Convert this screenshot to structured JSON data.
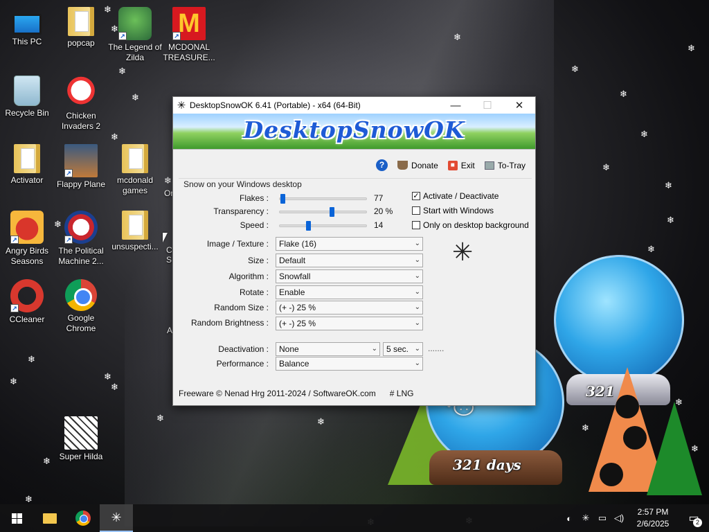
{
  "desktop": {
    "icons": [
      {
        "label": "This PC",
        "icon": "this-pc-icon"
      },
      {
        "label": "popcap",
        "icon": "folder-icon"
      },
      {
        "label": "The Legend of Zilda",
        "icon": "game-icon"
      },
      {
        "label": "MCDONAL TREASURE...",
        "icon": "mcdonalds-icon"
      },
      {
        "label": "Recycle Bin",
        "icon": "recycle-bin-icon"
      },
      {
        "label": "Chicken Invaders 2",
        "icon": "chicken-icon"
      },
      {
        "label": "Activator",
        "icon": "folder-icon"
      },
      {
        "label": "Flappy Plane",
        "icon": "flappy-plane-icon"
      },
      {
        "label": "mcdonald games",
        "icon": "folder-icon"
      },
      {
        "label": "Angry Birds Seasons",
        "icon": "angry-birds-icon"
      },
      {
        "label": "The Political Machine 2...",
        "icon": "political-machine-icon"
      },
      {
        "label": "unsuspecti...",
        "icon": "folder-icon"
      },
      {
        "label": "CCleaner",
        "icon": "ccleaner-icon"
      },
      {
        "label": "Google Chrome",
        "icon": "chrome-icon"
      },
      {
        "label": "Super Hilda",
        "icon": "super-hilda-icon"
      }
    ],
    "partial_labels": [
      "Or",
      "A",
      "C S"
    ],
    "shortcut_arrow": "↗"
  },
  "window": {
    "title": "DesktopSnowOK 6.41 (Portable) - x64 (64-Bit)",
    "app_icon_glyph": "✳",
    "minimize_glyph": "—",
    "maximize_glyph": "☐",
    "close_glyph": "✕",
    "banner_text": "DesktopSnowOK",
    "toolbar": {
      "help_glyph": "?",
      "donate": "Donate",
      "exit": "Exit",
      "exit_glyph": "■",
      "to_tray": "To-Tray"
    },
    "group_label": "Snow on your Windows desktop",
    "sliders": [
      {
        "label": "Flakes :",
        "value_text": "77",
        "fraction": 0.03
      },
      {
        "label": "Transparency :",
        "value_text": "20 %",
        "fraction": 0.6
      },
      {
        "label": "Speed :",
        "value_text": "14",
        "fraction": 0.33
      }
    ],
    "checkboxes": [
      {
        "label": "Activate / Deactivate",
        "checked": true,
        "mark": "✓"
      },
      {
        "label": "Start with Windows",
        "checked": false,
        "mark": ""
      },
      {
        "label": "Only on desktop background",
        "checked": false,
        "mark": ""
      }
    ],
    "dropdowns": [
      {
        "label": "Image / Texture :",
        "value": "Flake (16)"
      },
      {
        "label": "Size :",
        "value": "Default"
      },
      {
        "label": "Algorithm :",
        "value": "Snowfall"
      },
      {
        "label": "Rotate :",
        "value": "Enable"
      },
      {
        "label": "Random Size :",
        "value": "(+ -) 25 %"
      },
      {
        "label": "Random Brightness :",
        "value": "(+ -) 25 %"
      },
      {
        "label": "Deactivation :",
        "value": "None"
      },
      {
        "label": "Performance :",
        "value": "Balance"
      }
    ],
    "deactivation_time": "5 sec.",
    "dropdown_arrow": "⌄",
    "dotted_text": ".......",
    "preview_glyph": "✳",
    "footer_copyright": "Freeware © Nenad Hrg 2011-2024 / SoftwareOK.com",
    "footer_lng": "# LNG"
  },
  "decorations": {
    "globe_label": "321 days",
    "globe_label_small": "321"
  },
  "taskbar": {
    "time": "2:57 PM",
    "date": "2/6/2025",
    "notification_count": "2",
    "snow_glyph": "✳",
    "tray_icons": [
      "ccleaner-tray-icon",
      "snowflake-tray-icon",
      "network-icon",
      "volume-icon"
    ],
    "tray_glyphs": [
      "◐",
      "✳",
      "▭",
      "◁)"
    ],
    "notif_glyph": "▭"
  }
}
